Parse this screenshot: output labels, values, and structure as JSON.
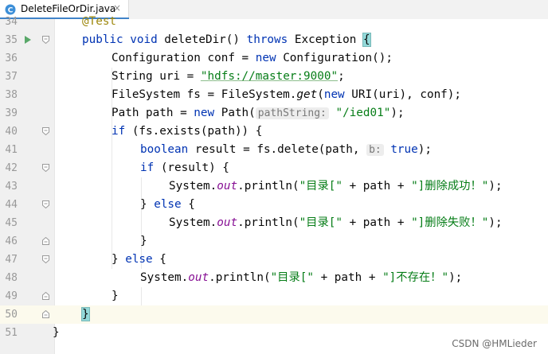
{
  "tab": {
    "title": "DeleteFileOrDir.java",
    "close": "×",
    "icon": "java-class-icon"
  },
  "editor": {
    "current_line": "50",
    "lines": [
      {
        "number": "34",
        "text": ""
      },
      {
        "number": "35",
        "text": ""
      },
      {
        "number": "36",
        "text": ""
      },
      {
        "number": "37",
        "text": ""
      },
      {
        "number": "38",
        "text": ""
      },
      {
        "number": "39",
        "text": ""
      },
      {
        "number": "40",
        "text": ""
      },
      {
        "number": "41",
        "text": ""
      },
      {
        "number": "42",
        "text": ""
      },
      {
        "number": "43",
        "text": ""
      },
      {
        "number": "44",
        "text": ""
      },
      {
        "number": "45",
        "text": ""
      },
      {
        "number": "46",
        "text": ""
      },
      {
        "number": "47",
        "text": ""
      },
      {
        "number": "48",
        "text": ""
      },
      {
        "number": "49",
        "text": ""
      },
      {
        "number": "50",
        "text": ""
      },
      {
        "number": "51",
        "text": ""
      }
    ],
    "tokens": {
      "annotation": "@Test",
      "kw_public": "public",
      "kw_void": "void",
      "method_name": " deleteDir() ",
      "kw_throws": "throws",
      "exception": " Exception ",
      "brace_open": "{",
      "l36_a": "Configuration conf = ",
      "kw_new": "new",
      "l36_b": " Configuration();",
      "l37_a": "String uri = ",
      "l37_str": "\"hdfs://master:9000\"",
      "l37_b": ";",
      "l38_a": "FileSystem fs = FileSystem.",
      "l38_get": "get",
      "l38_b": "(",
      "l38_c": " URI(uri), conf);",
      "l39_a": "Path path = ",
      "l39_b": " Path(",
      "l39_hint": "pathString:",
      "l39_str": "\"/ied01\"",
      "l39_c": ");",
      "kw_if": "if",
      "l40_b": " (fs.exists(path)) {",
      "kw_boolean": "boolean",
      "l41_b": " result = fs.delete(path, ",
      "l41_hint": "b:",
      "kw_true": "true",
      "l41_c": ");",
      "l42_b": " (result) {",
      "sys": "System.",
      "out": "out",
      "println": ".println(",
      "str_open": "\"目录[\"",
      "plus_path": " + path + ",
      "str_ok": "\"]删除成功！\"",
      "end_paren": ");",
      "close_else_a": "} ",
      "kw_else": "else",
      "close_else_b": " {",
      "str_fail": "\"]删除失败！\"",
      "brace_close": "}",
      "str_notexist": "\"]不存在！\""
    }
  },
  "watermark": "CSDN @HMLieder"
}
